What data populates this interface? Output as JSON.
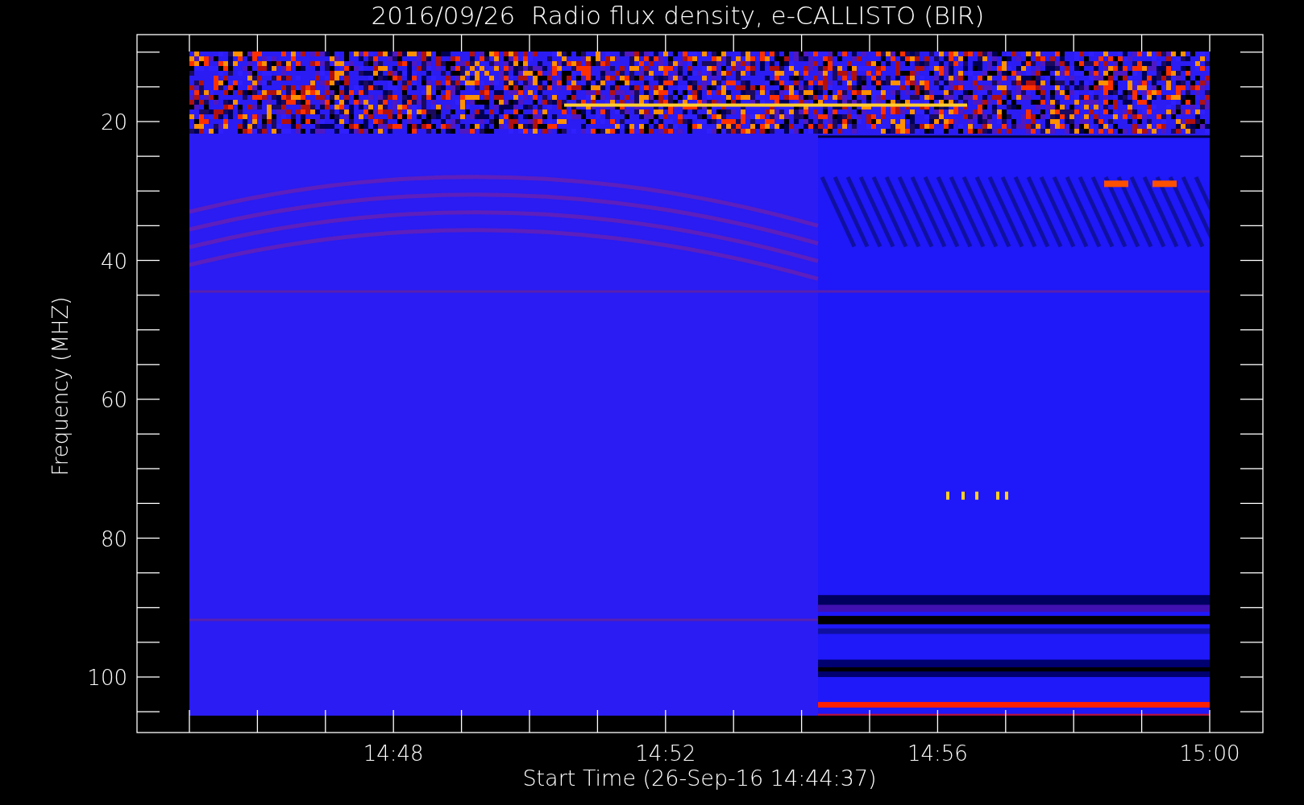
{
  "title": "2016/09/26  Radio flux density, e-CALLISTO (BIR)",
  "y_axis": {
    "label": "Frequency (MHZ)",
    "ticks": [
      "20",
      "40",
      "60",
      "80",
      "100"
    ]
  },
  "x_axis": {
    "label": "Start Time (26-Sep-16 14:44:37)",
    "ticks": [
      "14:48",
      "14:52",
      "14:56",
      "15:00"
    ]
  }
}
